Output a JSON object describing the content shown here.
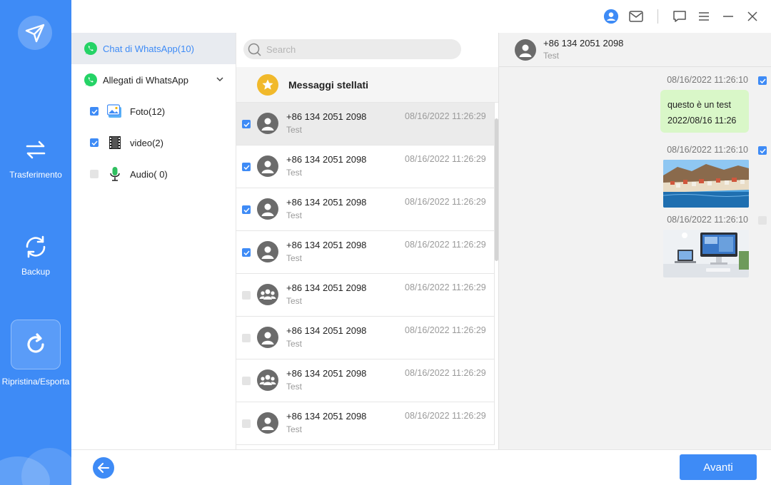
{
  "colors": {
    "accent": "#3e8bf6",
    "whatsapp": "#25d366",
    "bubble": "#d9f7c8",
    "star": "#f1b92b"
  },
  "nav": {
    "logo_icon": "paper-plane-logo",
    "items": [
      {
        "label": "Trasferimento",
        "icon": "transfer-arrows-icon"
      },
      {
        "label": "Backup",
        "icon": "sync-icon"
      },
      {
        "label": "Ripristina/Esporta",
        "icon": "restore-icon"
      }
    ]
  },
  "titlebar": {
    "icons": [
      "user-icon",
      "mail-icon",
      "feedback-icon",
      "menu-icon",
      "minimize-icon",
      "close-icon"
    ]
  },
  "categories": {
    "chat": "Chat di WhatsApp(10)",
    "attachments": "Allegati di WhatsApp",
    "sub": [
      {
        "label": "Foto(12)",
        "checked": true,
        "icon": "photo-icon"
      },
      {
        "label": "video(2)",
        "checked": true,
        "icon": "film-icon"
      },
      {
        "label": "Audio( 0)",
        "checked": false,
        "icon": "microphone-icon"
      }
    ]
  },
  "search": {
    "placeholder": "Search"
  },
  "starred": {
    "label": "Messaggi stellati"
  },
  "chats": [
    {
      "name": "+86 134 2051 2098",
      "preview": "Test",
      "time": "08/16/2022 11:26:29",
      "checked": true,
      "group": false,
      "selected": true
    },
    {
      "name": "+86 134 2051 2098",
      "preview": "Test",
      "time": "08/16/2022 11:26:29",
      "checked": true,
      "group": false
    },
    {
      "name": "+86 134 2051 2098",
      "preview": "Test",
      "time": "08/16/2022 11:26:29",
      "checked": true,
      "group": false
    },
    {
      "name": "+86 134 2051 2098",
      "preview": "Test",
      "time": "08/16/2022 11:26:29",
      "checked": true,
      "group": false
    },
    {
      "name": "+86 134 2051 2098",
      "preview": "Test",
      "time": "08/16/2022 11:26:29",
      "checked": false,
      "group": true
    },
    {
      "name": "+86 134 2051 2098",
      "preview": "Test",
      "time": "08/16/2022 11:26:29",
      "checked": false,
      "group": false
    },
    {
      "name": "+86 134 2051 2098",
      "preview": "Test",
      "time": "08/16/2022 11:26:29",
      "checked": false,
      "group": true
    },
    {
      "name": "+86 134 2051 2098",
      "preview": "Test",
      "time": "08/16/2022 11:26:29",
      "checked": false,
      "group": false
    }
  ],
  "detail": {
    "name": "+86 134 2051 2098",
    "preview": "Test",
    "messages": [
      {
        "time": "08/16/2022 11:26:10",
        "checked": true,
        "text1": "questo è un test",
        "text2": "2022/08/16 11:26"
      },
      {
        "time": "08/16/2022 11:26:10",
        "checked": true,
        "image": "coastal-town-photo"
      },
      {
        "time": "08/16/2022 11:26:10",
        "checked": false,
        "image": "desk-computer-photo"
      }
    ]
  },
  "footer": {
    "next": "Avanti",
    "back_icon": "arrow-left-icon"
  }
}
